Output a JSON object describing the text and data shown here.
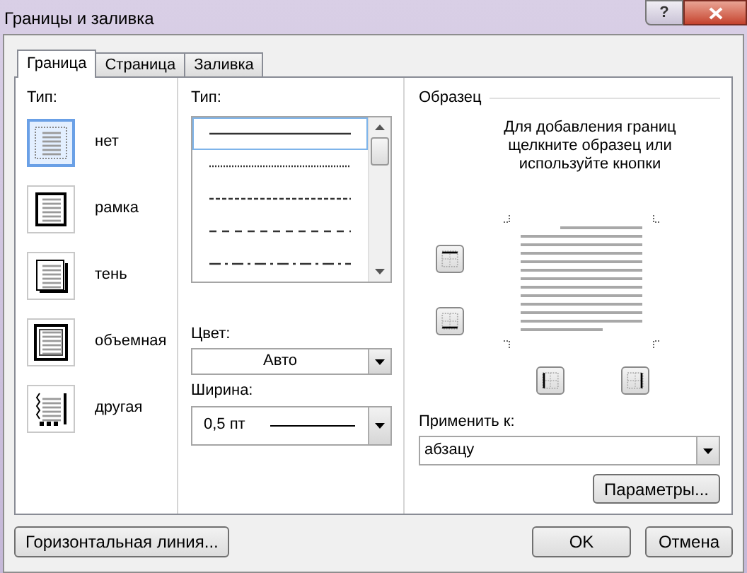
{
  "window": {
    "title": "Границы и заливка",
    "help": "?"
  },
  "tabs": [
    {
      "label": "Граница",
      "selected": true
    },
    {
      "label": "Страница",
      "selected": false
    },
    {
      "label": "Заливка",
      "selected": false
    }
  ],
  "setting": {
    "label": "Тип:",
    "items": [
      {
        "kind": "none",
        "label": "нет",
        "selected": true
      },
      {
        "kind": "box",
        "label": "рамка",
        "selected": false
      },
      {
        "kind": "shadow",
        "label": "тень",
        "selected": false
      },
      {
        "kind": "raised",
        "label": "объемная",
        "selected": false
      },
      {
        "kind": "custom",
        "label": "другая",
        "selected": false
      }
    ]
  },
  "style": {
    "label": "Тип:",
    "lines": [
      {
        "kind": "solid",
        "selected": true
      },
      {
        "kind": "dotted",
        "selected": false
      },
      {
        "kind": "fine-dashed",
        "selected": false
      },
      {
        "kind": "dashed",
        "selected": false
      },
      {
        "kind": "dash-dot",
        "selected": false
      }
    ]
  },
  "color": {
    "label": "Цвет:",
    "value": "Авто"
  },
  "width": {
    "label": "Ширина:",
    "value": "0,5 пт"
  },
  "preview": {
    "title": "Образец",
    "hint": "Для добавления границ щелкните образец или используйте кнопки"
  },
  "apply": {
    "label": "Применить к:",
    "value": "абзацу"
  },
  "options_button": "Параметры...",
  "footer": {
    "horizontal_line": "Горизонтальная линия...",
    "ok": "OK",
    "cancel": "Отмена"
  }
}
